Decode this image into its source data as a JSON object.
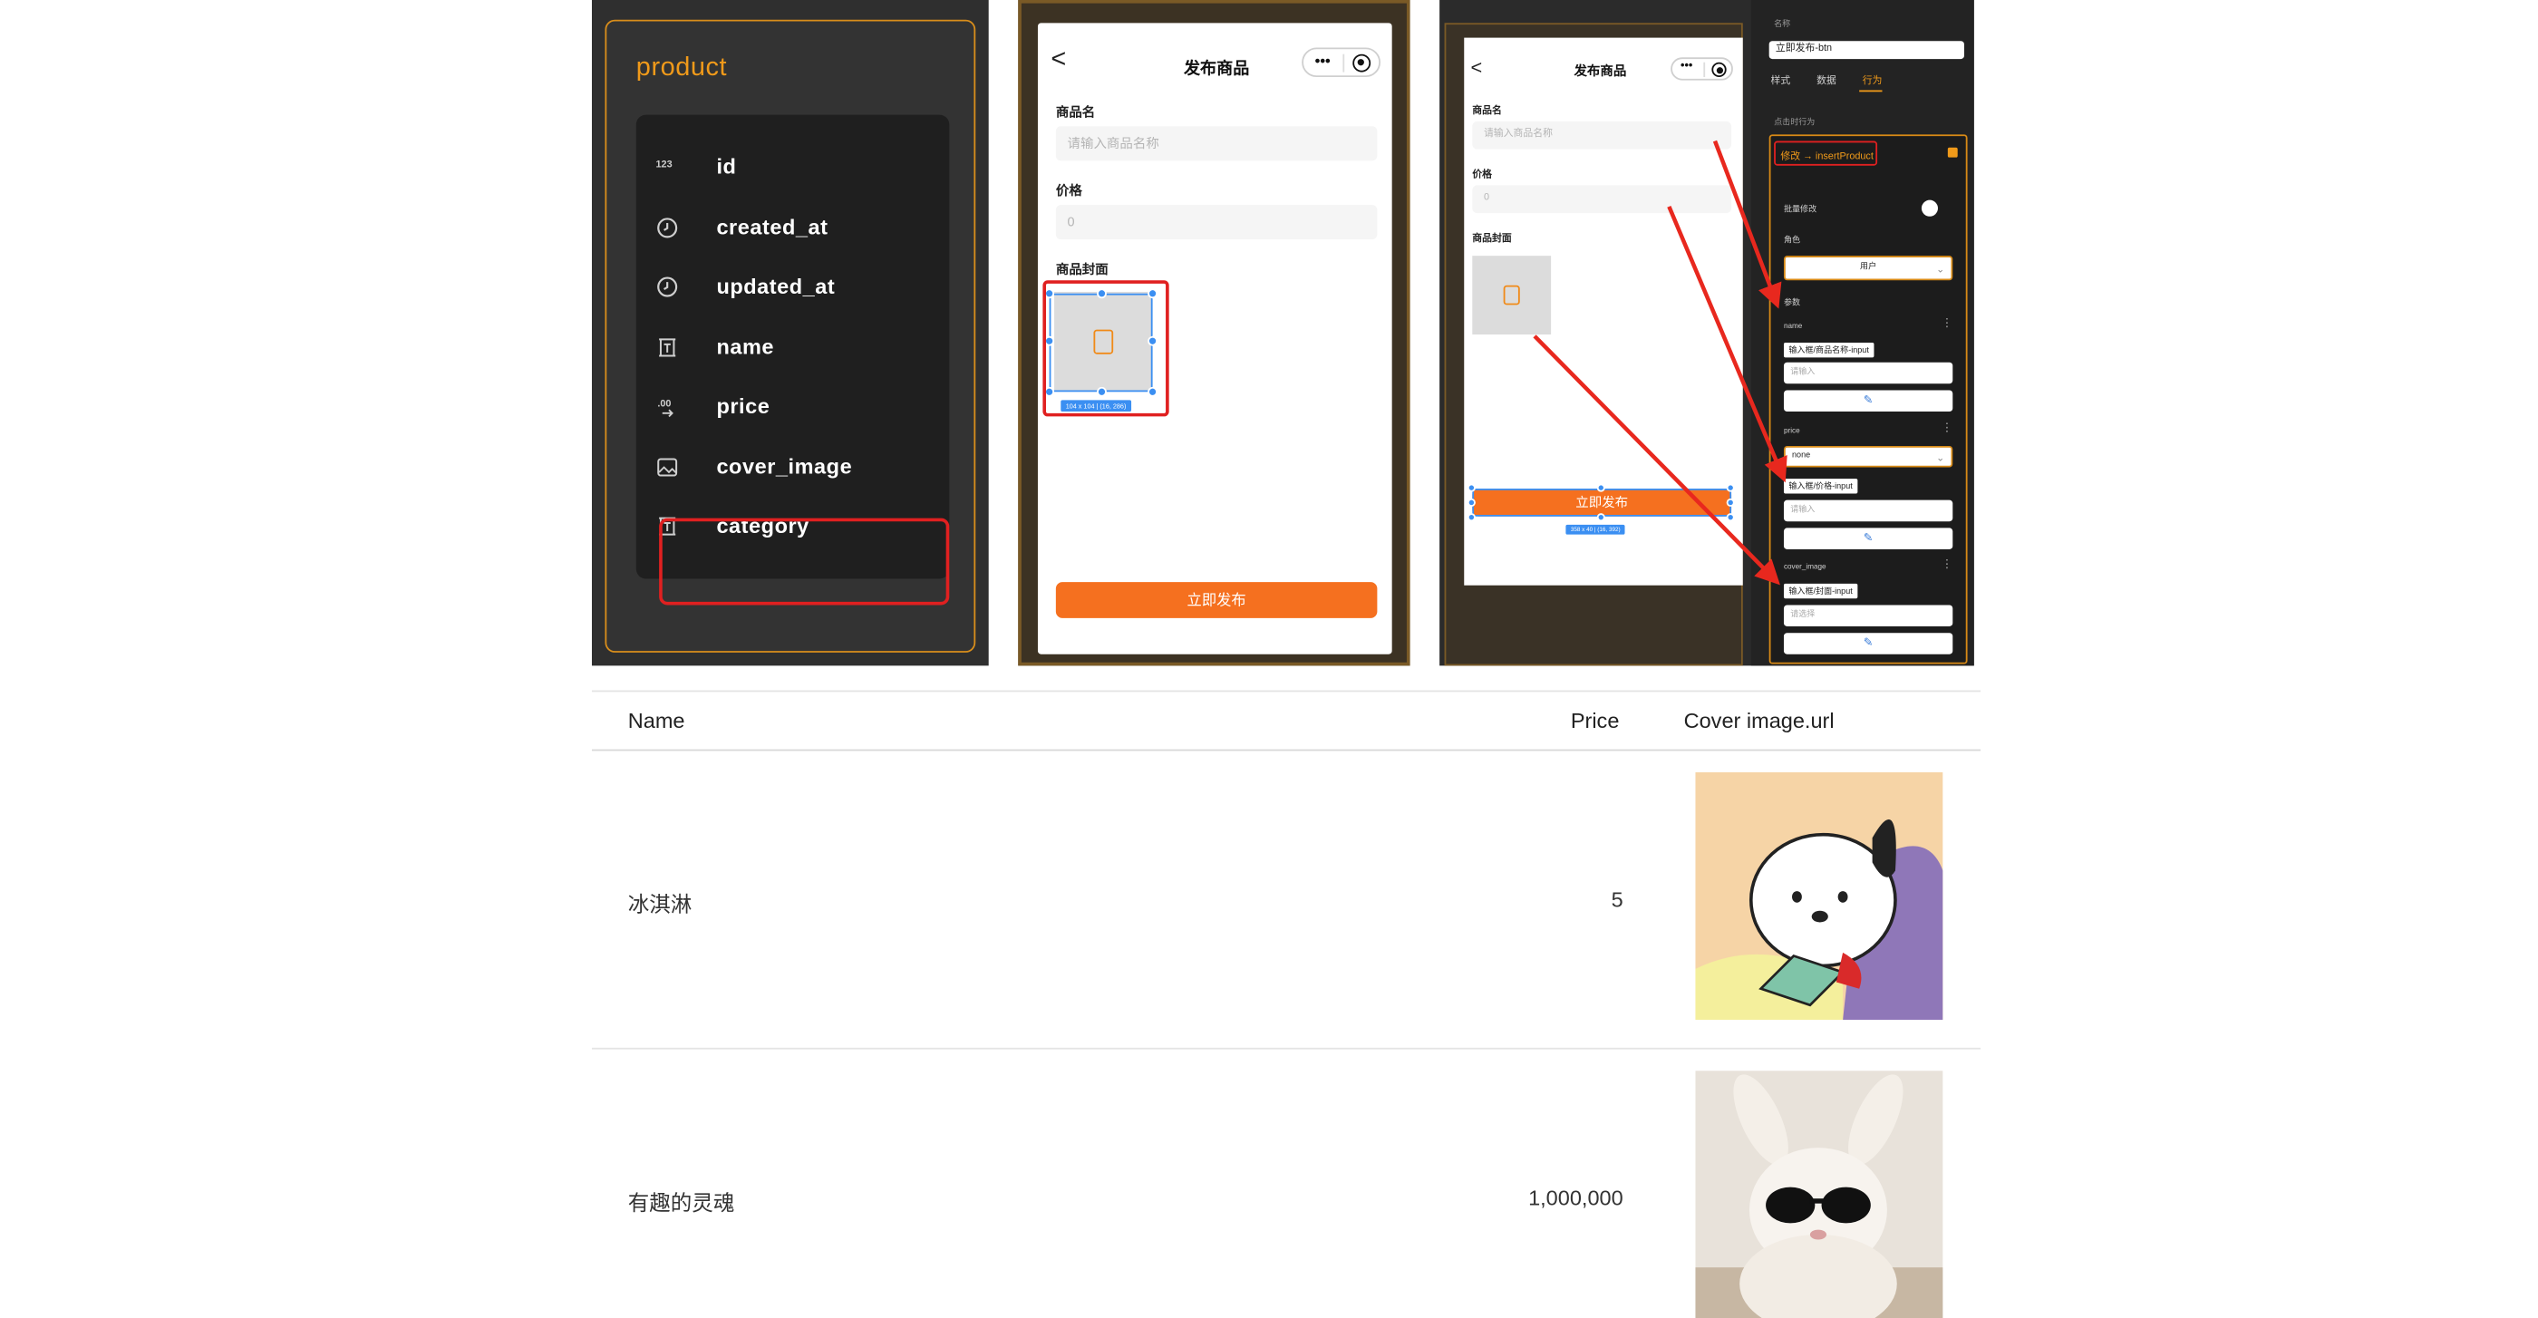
{
  "schema_panel": {
    "title": "product",
    "fields": [
      {
        "icon": "number-icon",
        "name": "id"
      },
      {
        "icon": "clock-icon",
        "name": "created_at"
      },
      {
        "icon": "clock-icon",
        "name": "updated_at"
      },
      {
        "icon": "text-icon",
        "name": "name"
      },
      {
        "icon": "decimal-icon",
        "name": "price"
      },
      {
        "icon": "image-icon",
        "name": "cover_image"
      },
      {
        "icon": "text-icon",
        "name": "category"
      }
    ]
  },
  "phone_preview": {
    "back": "<",
    "title": "发布商品",
    "name_label": "商品名",
    "name_placeholder": "请输入商品名称",
    "price_label": "价格",
    "price_placeholder": "0",
    "cover_label": "商品封面",
    "size_tag": "104 x 104 | (16, 286)",
    "publish_button": "立即发布"
  },
  "editor": {
    "phone": {
      "back": "<",
      "title": "发布商品",
      "name_label": "商品名",
      "name_placeholder": "请输入商品名称",
      "price_label": "价格",
      "price_placeholder": "0",
      "cover_label": "商品封面",
      "publish_button": "立即发布",
      "size_tag": "358 x 40 | (16, 392)"
    },
    "props": {
      "name_label": "名称",
      "name_value": "立即发布-btn",
      "tabs": [
        "样式",
        "数据",
        "行为"
      ],
      "active_tab": "行为",
      "on_click_label": "点击时行为",
      "action": "修改 → insertProduct",
      "batch_label": "批量修改",
      "role_label": "角色",
      "role_value": "用户",
      "params_label": "参数",
      "params": [
        {
          "name": "name",
          "chip": "输入框/商品名称-input",
          "placeholder": "请输入",
          "select": ""
        },
        {
          "name": "price",
          "chip": "输入框/价格-input",
          "placeholder": "请输入",
          "select": "none"
        },
        {
          "name": "cover_image",
          "chip": "输入框/封面-input",
          "placeholder": "请选择",
          "select": ""
        }
      ]
    }
  },
  "table": {
    "headers": [
      "Name",
      "Price",
      "Cover image.url"
    ],
    "rows": [
      {
        "name": "冰淇淋",
        "price": "5",
        "image": "dog-cartoon-image"
      },
      {
        "name": "有趣的灵魂",
        "price": "1,000,000",
        "image": "bunny-plush-image"
      }
    ]
  },
  "colors": {
    "accent": "#f09a1a",
    "highlight": "#e02020",
    "button": "#f5701f",
    "selection": "#3b8ff2"
  }
}
